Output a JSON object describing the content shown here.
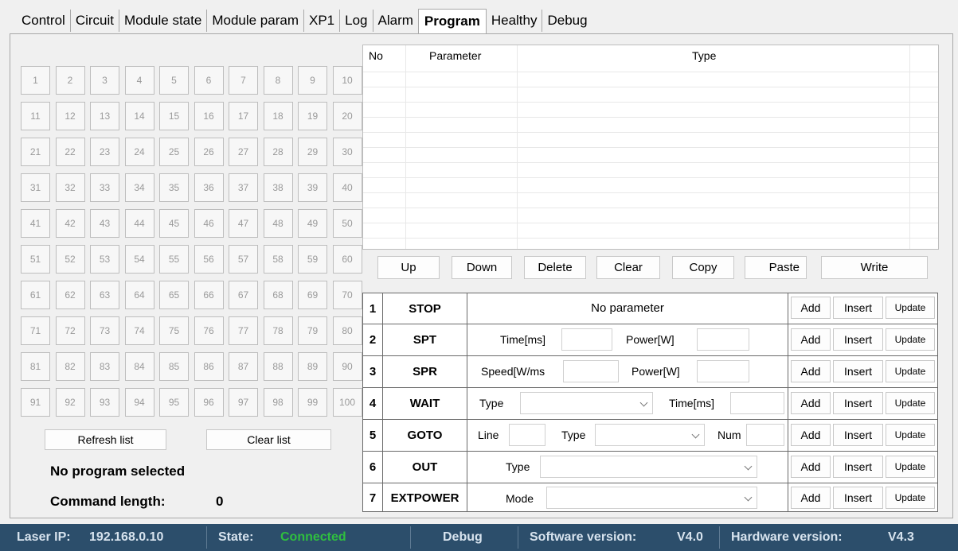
{
  "tabs": [
    "Control",
    "Circuit",
    "Module state",
    "Module param",
    "XP1",
    "Log",
    "Alarm",
    "Program",
    "Healthy",
    "Debug"
  ],
  "active_tab": "Program",
  "grid": {
    "count": 100
  },
  "left_buttons": {
    "refresh": "Refresh list",
    "clear": "Clear list"
  },
  "program_status": "No program selected",
  "command_length": {
    "label": "Command length:",
    "value": "0"
  },
  "table": {
    "columns": [
      "No",
      "Parameter",
      "Type"
    ]
  },
  "table_buttons": {
    "up": "Up",
    "down": "Down",
    "delete": "Delete",
    "clear": "Clear",
    "copy": "Copy",
    "paste": "Paste",
    "write": "Write"
  },
  "commands": {
    "stop": {
      "num": "1",
      "name": "STOP",
      "text": "No parameter"
    },
    "spt": {
      "num": "2",
      "name": "SPT",
      "label1": "Time[ms]",
      "label2": "Power[W]"
    },
    "spr": {
      "num": "3",
      "name": "SPR",
      "label1": "Speed[W/ms",
      "label2": "Power[W]"
    },
    "wait": {
      "num": "4",
      "name": "WAIT",
      "label1": "Type",
      "label2": "Time[ms]"
    },
    "goto": {
      "num": "5",
      "name": "GOTO",
      "label1": "Line",
      "label2": "Type",
      "label3": "Num"
    },
    "out": {
      "num": "6",
      "name": "OUT",
      "label1": "Type"
    },
    "extpower": {
      "num": "7",
      "name": "EXTPOWER",
      "label1": "Mode"
    }
  },
  "row_actions": {
    "add": "Add",
    "insert": "Insert",
    "update": "Update"
  },
  "status_bar": {
    "ip_label": "Laser IP:",
    "ip": "192.168.0.10",
    "state_label": "State:",
    "state": "Connected",
    "mode": "Debug",
    "sw_label": "Software version:",
    "sw": "V4.0",
    "hw_label": "Hardware version:",
    "hw": "V4.3"
  },
  "colors": {
    "status_bg": "#2c4e6b",
    "connected": "#2fbf3f"
  }
}
